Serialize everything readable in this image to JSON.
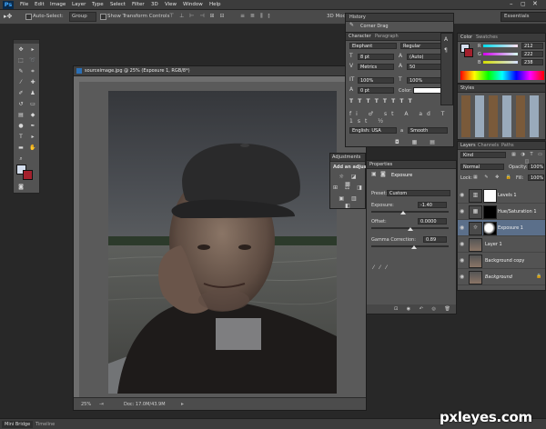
{
  "app_logo": "Ps",
  "menu": [
    "File",
    "Edit",
    "Image",
    "Layer",
    "Type",
    "Select",
    "Filter",
    "3D",
    "View",
    "Window",
    "Help"
  ],
  "options_bar": {
    "auto_select_label": "Auto-Select:",
    "auto_select_value": "Group",
    "show_transform_label": "Show Transform Controls",
    "mode_3d_label": "3D Mode:",
    "workspace": "Essentials"
  },
  "document": {
    "title": "sourceimage.jpg @ 25% (Exposure 1, RGB/8*)",
    "zoom": "25%",
    "doc_size": "Doc: 17.0M/43.9M"
  },
  "history_panel": {
    "tab": "History",
    "item": "Corner Drag"
  },
  "character_panel": {
    "tabs": [
      "Character",
      "Paragraph"
    ],
    "font_family": "Elephant",
    "font_style": "Regular",
    "font_size": "8 pt",
    "leading": "(Auto)",
    "kerning": "Metrics",
    "tracking": "50",
    "vscale": "100%",
    "hscale": "100%",
    "baseline": "0 pt",
    "color_label": "Color:",
    "language": "English: USA",
    "aa_label": "a",
    "antialias": "Smooth"
  },
  "adjustments_panel": {
    "tab": "Adjustments",
    "add_label": "Add an adjustment"
  },
  "properties_panel": {
    "tab": "Properties",
    "type": "Exposure",
    "preset_label": "Preset:",
    "preset_value": "Custom",
    "exposure_label": "Exposure:",
    "exposure_value": "-1.40",
    "offset_label": "Offset:",
    "offset_value": "0.0000",
    "gamma_label": "Gamma Correction:",
    "gamma_value": "0.89"
  },
  "color_panel": {
    "tabs": [
      "Color",
      "Swatches"
    ],
    "r_label": "R",
    "r": "212",
    "g_label": "G",
    "g": "222",
    "b_label": "B",
    "b": "238"
  },
  "styles_panel": {
    "tab": "Styles"
  },
  "layers_panel": {
    "tabs": [
      "Layers",
      "Channels",
      "Paths"
    ],
    "filter": "Kind",
    "blend_mode": "Normal",
    "opacity_label": "Opacity:",
    "opacity": "100%",
    "lock_label": "Lock:",
    "fill_label": "Fill:",
    "fill": "100%",
    "layers": [
      {
        "name": "Levels 1"
      },
      {
        "name": "Hue/Saturation 1"
      },
      {
        "name": "Exposure 1"
      },
      {
        "name": "Layer 1"
      },
      {
        "name": "Background copy"
      },
      {
        "name": "Background"
      }
    ]
  },
  "bottom_tabs": [
    "Mini Bridge",
    "Timeline"
  ],
  "watermark": "pxleyes.com",
  "colors": {
    "chrome": "#535353",
    "dark_chrome": "#3b3b3b",
    "selected_layer": "#5b6f8a",
    "foreground_swatch": "#d4deee",
    "background_swatch": "#a3202d",
    "ps_blue": "#3fa7ff"
  }
}
